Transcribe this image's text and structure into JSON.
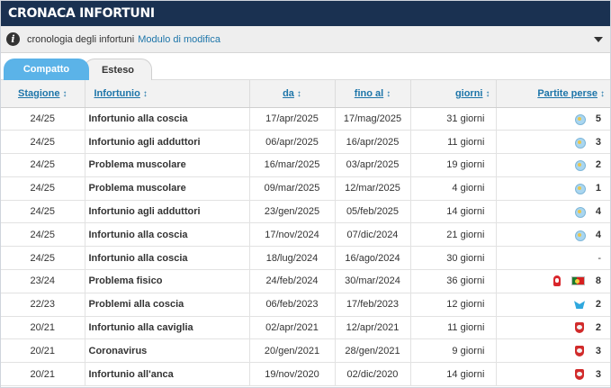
{
  "header": {
    "title": "CRONACA INFORTUNI"
  },
  "infobar": {
    "text": "cronologia degli infortuni",
    "link": "Modulo di modifica"
  },
  "tabs": [
    {
      "label": "Compatto",
      "active": true
    },
    {
      "label": "Esteso",
      "active": false
    }
  ],
  "table": {
    "columns": [
      {
        "label": "Stagione",
        "sort": "↕"
      },
      {
        "label": "Infortunio",
        "sort": "↕"
      },
      {
        "label": "da",
        "sort": "↕"
      },
      {
        "label": "fino al",
        "sort": "↕"
      },
      {
        "label": "giorni",
        "sort": "↕"
      },
      {
        "label": "Partite perse",
        "sort": "↕"
      }
    ],
    "rows": [
      {
        "season": "24/25",
        "injury": "Infortunio alla coscia",
        "from": "17/apr/2025",
        "until": "17/mag/2025",
        "days": "31 giorni",
        "clubs": [
          "lazio-crest-icon"
        ],
        "games": "5"
      },
      {
        "season": "24/25",
        "injury": "Infortunio agli adduttori",
        "from": "06/apr/2025",
        "until": "16/apr/2025",
        "days": "11 giorni",
        "clubs": [
          "lazio-crest-icon"
        ],
        "games": "3"
      },
      {
        "season": "24/25",
        "injury": "Problema muscolare",
        "from": "16/mar/2025",
        "until": "03/apr/2025",
        "days": "19 giorni",
        "clubs": [
          "lazio-crest-icon"
        ],
        "games": "2"
      },
      {
        "season": "24/25",
        "injury": "Problema muscolare",
        "from": "09/mar/2025",
        "until": "12/mar/2025",
        "days": "4 giorni",
        "clubs": [
          "lazio-crest-icon"
        ],
        "games": "1"
      },
      {
        "season": "24/25",
        "injury": "Infortunio agli adduttori",
        "from": "23/gen/2025",
        "until": "05/feb/2025",
        "days": "14 giorni",
        "clubs": [
          "lazio-crest-icon"
        ],
        "games": "4"
      },
      {
        "season": "24/25",
        "injury": "Infortunio alla coscia",
        "from": "17/nov/2024",
        "until": "07/dic/2024",
        "days": "21 giorni",
        "clubs": [
          "lazio-crest-icon"
        ],
        "games": "4"
      },
      {
        "season": "24/25",
        "injury": "Infortunio alla coscia",
        "from": "18/lug/2024",
        "until": "16/ago/2024",
        "days": "30 giorni",
        "clubs": [],
        "games": "-"
      },
      {
        "season": "23/24",
        "injury": "Problema fisico",
        "from": "24/feb/2024",
        "until": "30/mar/2024",
        "days": "36 giorni",
        "clubs": [
          "nottingham-forest-crest-icon",
          "portugal-flag-icon"
        ],
        "games": "8"
      },
      {
        "season": "22/23",
        "injury": "Problemi alla coscia",
        "from": "06/feb/2023",
        "until": "17/feb/2023",
        "days": "12 giorni",
        "clubs": [
          "marseille-crest-icon"
        ],
        "games": "2"
      },
      {
        "season": "20/21",
        "injury": "Infortunio alla caviglia",
        "from": "02/apr/2021",
        "until": "12/apr/2021",
        "days": "11 giorni",
        "clubs": [
          "benfica-crest-icon"
        ],
        "games": "2"
      },
      {
        "season": "20/21",
        "injury": "Coronavirus",
        "from": "20/gen/2021",
        "until": "28/gen/2021",
        "days": "9 giorni",
        "clubs": [
          "benfica-crest-icon"
        ],
        "games": "3"
      },
      {
        "season": "20/21",
        "injury": "Infortunio all'anca",
        "from": "19/nov/2020",
        "until": "02/dic/2020",
        "days": "14 giorni",
        "clubs": [
          "benfica-crest-icon"
        ],
        "games": "3"
      }
    ]
  }
}
